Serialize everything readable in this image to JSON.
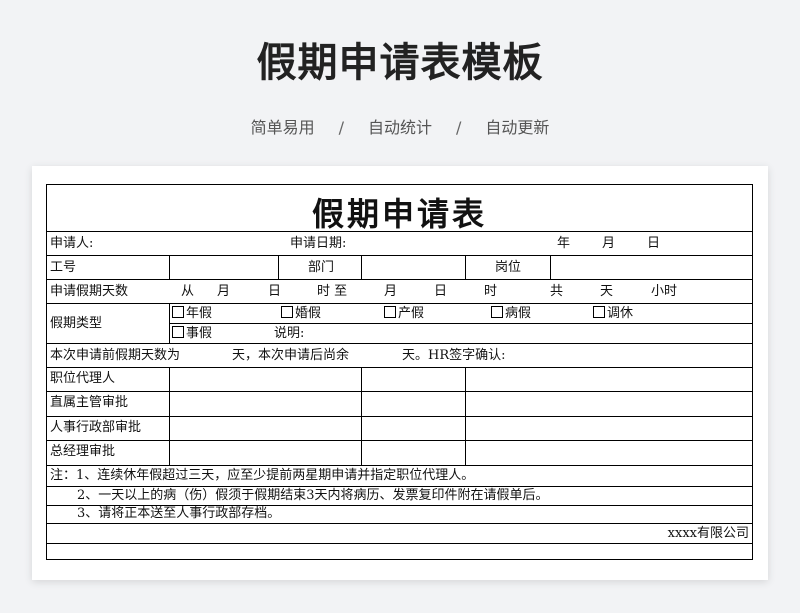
{
  "header": {
    "title": "假期申请表模板",
    "tags": [
      "简单易用",
      "自动统计",
      "自动更新"
    ],
    "separator": "/"
  },
  "form": {
    "title": "假期申请表",
    "row1": {
      "applicant": "申请人:",
      "apply_date": "申请日期:",
      "year": "年",
      "month": "月",
      "day": "日"
    },
    "row2": {
      "employee_id": "工号",
      "department": "部门",
      "position": "岗位"
    },
    "row3": {
      "label": "申请假期天数",
      "from": "从",
      "month1": "月",
      "day1": "日",
      "hour_to": "时 至",
      "month2": "月",
      "day2": "日",
      "hour2": "时",
      "total": "共",
      "days": "天",
      "hours": "小时"
    },
    "row4": {
      "label": "假期类型",
      "options": [
        "年假",
        "婚假",
        "产假",
        "病假",
        "调休",
        "事假"
      ],
      "note": "说明:"
    },
    "row5": {
      "before": "本次申请前假期天数为",
      "mid": "天，本次申请后尚余",
      "after": "天。HR签字确认:"
    },
    "approvals": [
      "职位代理人",
      "直属主管审批",
      "人事行政部审批",
      "总经理审批"
    ],
    "notes": [
      "注：1、连续休年假超过三天，应至少提前两星期申请并指定职位代理人。",
      "2、一天以上的病（伤）假须于假期结束3天内将病历、发票复印件附在请假单后。",
      "3、请将正本送至人事行政部存档。"
    ],
    "company": "xxxx有限公司"
  }
}
